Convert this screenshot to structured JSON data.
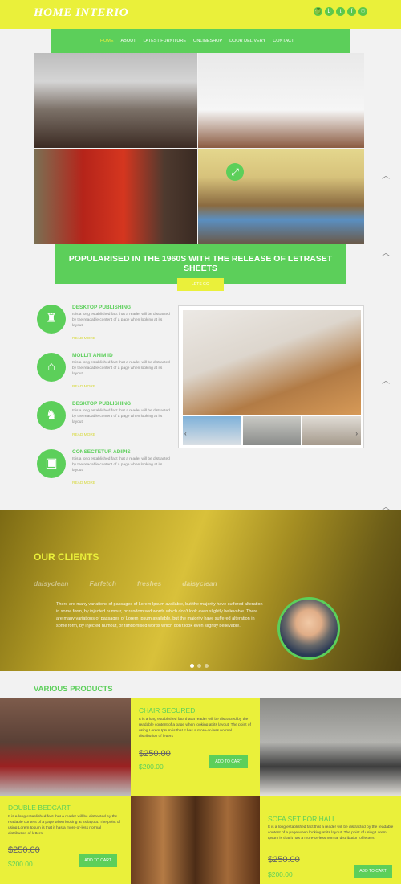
{
  "brand": {
    "logo": "HOME INTERIO"
  },
  "social": [
    "🍏",
    "b",
    "t",
    "f",
    "☉"
  ],
  "nav": [
    {
      "label": "HOME",
      "active": true
    },
    {
      "label": "ABOUT"
    },
    {
      "label": "LATEST FURNITURE"
    },
    {
      "label": "ONLINESHOP"
    },
    {
      "label": "DOOR DELIVERY"
    },
    {
      "label": "CONTACT"
    }
  ],
  "banner": {
    "title": "POPULARISED IN THE 1960S WITH THE RELEASE OF LETRASET SHEETS",
    "button": "LETS GO"
  },
  "features": [
    {
      "title": "DESKTOP PUBLISHING",
      "desc": "It is a long established fact that a reader will be distracted by the readable content of a page when looking at its layout.",
      "more": "READ MORE"
    },
    {
      "title": "MOLLIT ANIM ID",
      "desc": "It is a long established fact that a reader will be distracted by the readable content of a page when looking at its layout.",
      "more": "READ MORE"
    },
    {
      "title": "DESKTOP PUBLISHING",
      "desc": "It is a long established fact that a reader will be distracted by the readable content of a page when looking at its layout.",
      "more": "READ MORE"
    },
    {
      "title": "CONSECTETUR ADIPIS",
      "desc": "It is a long established fact that a reader will be distracted by the readable content of a page when looking at its layout.",
      "more": "READ MORE"
    }
  ],
  "clients": {
    "title": "OUR CLIENTS",
    "logos": [
      "daisyclean",
      "Farfetch",
      "freshes",
      "daisyclean"
    ],
    "testimonial": "There are many variations of passages of Lorem Ipsum available, but the majority have suffered alteration in some form, by injected humour, or randomised words which don't look even slightly believable. There are many variations of passages of Lorem Ipsum available, but the majority have suffered alteration in some form, by injected humour, or randomised words which don't look even slightly believable."
  },
  "products": {
    "title": "VARIOUS PRODUCTS",
    "items": [
      {
        "title": "CHAIR SECURED",
        "desc": "It is a long established fact that a reader will be distracted by the readable content of a page when looking at its layout. The point of using Lorem Ipsum is that it has a more-or-less normal distribution of letters",
        "old_price": "$250.00",
        "new_price": "$200.00",
        "button": "ADD TO CART"
      },
      {
        "title": "DOUBLE BEDCART",
        "desc": "It is a long established fact that a reader will be distracted by the readable content of a page when looking at its layout. The point of using Lorem Ipsum is that it has a more-or-less normal distribution of letters",
        "old_price": "$250.00",
        "new_price": "$200.00",
        "button": "ADD TO CART"
      },
      {
        "title": "SOFA SET FOR HALL",
        "desc": "It is a long established fact that a reader will be distracted by the readable content of a page when looking at its layout. The point of using Lorem Ipsum is that it has a more-or-less normal distribution of letters",
        "old_price": "$250.00",
        "new_price": "$200.00",
        "button": "ADD TO CART"
      }
    ]
  },
  "colors": {
    "yellow": "#eaf03a",
    "green": "#5ccf5a"
  }
}
